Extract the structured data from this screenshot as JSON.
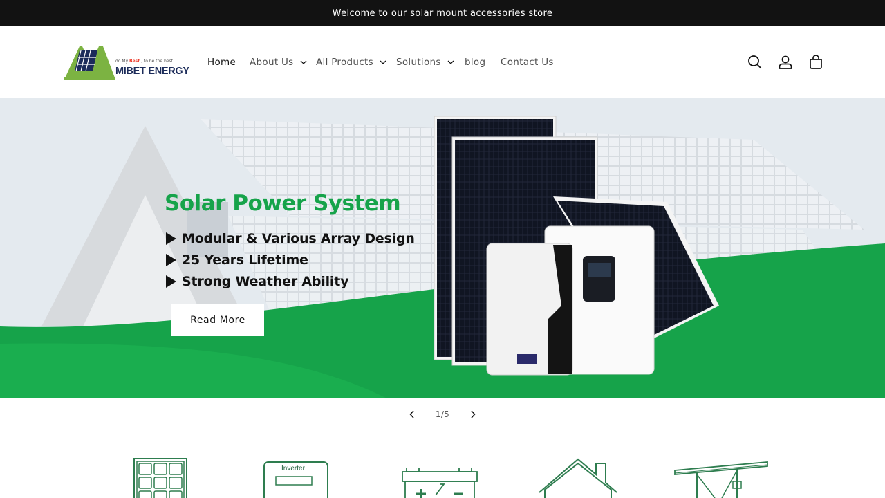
{
  "announcement": {
    "text": "Welcome to our solar mount accessories store"
  },
  "logo": {
    "tagline_pre": "do My ",
    "tagline_bold": "Best",
    "tagline_post": " , to be the best",
    "brand": "MIBET ENERGY"
  },
  "nav": {
    "items": [
      {
        "label": "Home",
        "dropdown": false,
        "active": true
      },
      {
        "label": "About Us",
        "dropdown": true
      },
      {
        "label": "All Products",
        "dropdown": true
      },
      {
        "label": "Solutions",
        "dropdown": true
      },
      {
        "label": "blog",
        "dropdown": false
      },
      {
        "label": "Contact Us",
        "dropdown": false
      }
    ]
  },
  "header_icons": [
    "search-icon",
    "account-icon",
    "cart-icon"
  ],
  "hero": {
    "title": "Solar Power System",
    "features": [
      "Modular & Various Array Design",
      "25 Years Lifetime",
      "Strong Weather Ability"
    ],
    "button": "Read More",
    "accent_color": "#16a34a"
  },
  "slider": {
    "counter_current": "1",
    "counter_sep": "/",
    "counter_total": "5"
  },
  "categories": {
    "icons": [
      "solar-panel-icon",
      "inverter-icon",
      "battery-icon",
      "house-icon",
      "mounting-structure-icon"
    ],
    "inverter_label": "Inverter"
  }
}
